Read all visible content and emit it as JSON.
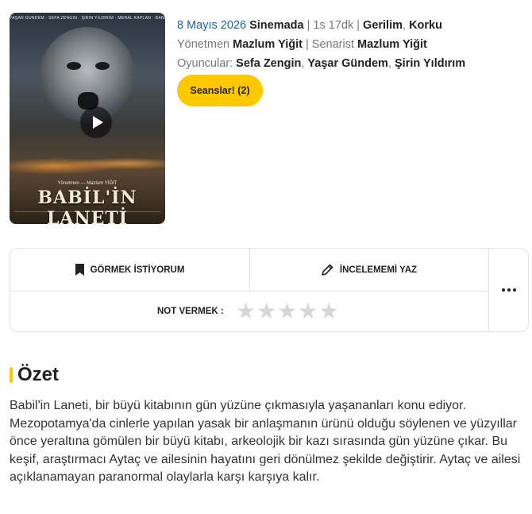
{
  "poster": {
    "credits_top": "YAŞAR GÜNDEM · SEFA ZENGİN · ŞİRİN YILDIRIM · MERAL KAPLAN · RANA KARAKAŞLI",
    "director_line": "Yönetmen — Mazlum YİĞİT",
    "title": "BABİL'İN LANETİ"
  },
  "info": {
    "date": "8 Mayıs 2026",
    "status": "Sinemada",
    "duration": "1s 17dk",
    "genres": [
      "Gerilim",
      "Korku"
    ],
    "director_label": "Yönetmen",
    "director": "Mazlum Yiğit",
    "writer_label": "Senarist",
    "writer": "Mazlum Yiğit",
    "cast_label": "Oyuncular:",
    "cast": [
      "Sefa Zengin",
      "Yaşar Gündem",
      "Şirin Yıldırım"
    ]
  },
  "sessions_button": "Seanslar! (2)",
  "actions": {
    "watchlist": "GÖRMEK İSTİYORUM",
    "review": "İNCELEMEMİ YAZ",
    "rate_label": "NOT VERMEK :",
    "rating_value": 0,
    "rating_max": 5
  },
  "summary": {
    "title": "Özet",
    "text": "Babil'in Laneti, bir büyü kitabının gün yüzüne çıkmasıyla yaşananları konu ediyor. Mezopotamya'da cinlerle yapılan yasak bir anlaşmanın ürünü olduğu söylenen ve yüzyıllar önce yeraltına gömülen bir büyü kitabı, arkeolojik bir kazı sırasında gün yüzüne çıkar. Bu keşif, araştırmacı Aytaç ve ailesinin hayatını geri dönülmez şekilde değiştirir. Aytaç ve ailesi açıklanamayan paranormal olaylarla karşı karşıya kalır."
  },
  "colors": {
    "accent": "#ffc800",
    "date_blue": "#1a5fa8",
    "star_empty": "#d6d6d6"
  }
}
